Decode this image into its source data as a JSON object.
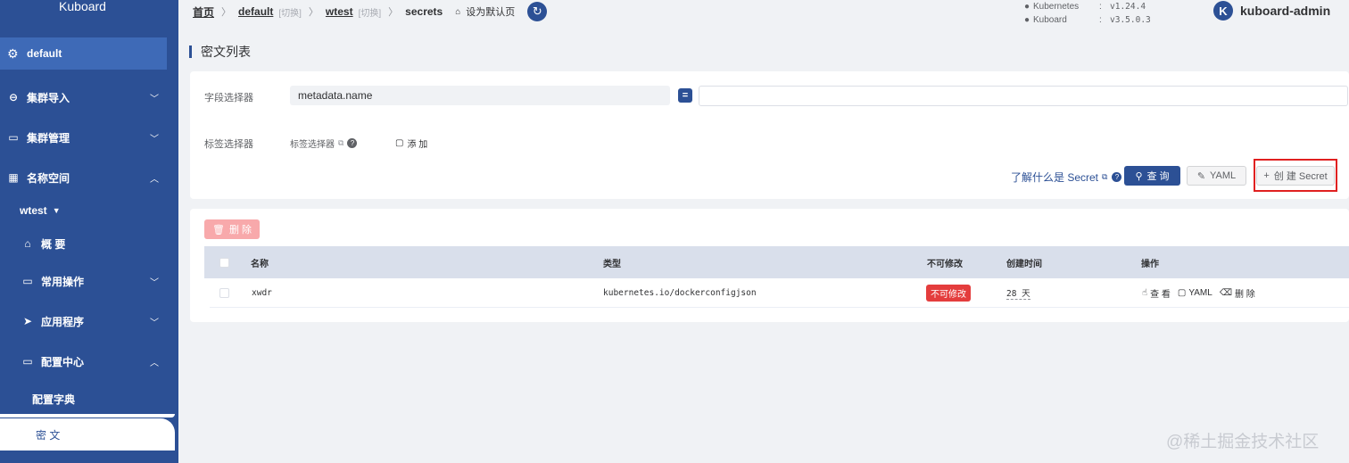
{
  "sidebar": {
    "brand": "Kuboard",
    "cluster": {
      "label": "default",
      "icon": "gear-icon"
    },
    "items": [
      {
        "label": "集群导入",
        "icon": "link-icon",
        "chevron": "﹀"
      },
      {
        "label": "集群管理",
        "icon": "folder-icon",
        "chevron": "﹀"
      },
      {
        "label": "名称空间",
        "icon": "grid-icon",
        "chevron": "︿"
      }
    ],
    "namespace": "wtest",
    "ns_items": [
      {
        "label": "概 要",
        "icon": "home-icon"
      },
      {
        "label": "常用操作",
        "icon": "folder-icon",
        "chevron": "﹀"
      },
      {
        "label": "应用程序",
        "icon": "send-icon",
        "chevron": "﹀"
      },
      {
        "label": "配置中心",
        "icon": "box-icon",
        "chevron": "︿"
      }
    ],
    "config_items": [
      {
        "label": "配置字典"
      },
      {
        "label": "密 文",
        "active": true
      }
    ]
  },
  "topbar": {
    "home": "首页",
    "cluster": "default",
    "cluster_switch": "[切换]",
    "namespace": "wtest",
    "namespace_switch": "[切换]",
    "resource": "secrets",
    "set_default": "设为默认页",
    "versions": [
      {
        "name": "Kubernetes",
        "value": "v1.24.4"
      },
      {
        "name": "Kuboard",
        "value": "v3.5.0.3"
      }
    ],
    "user_initial": "K",
    "user_name": "kuboard-admin"
  },
  "page": {
    "title": "密文列表"
  },
  "filter": {
    "field_selector_label": "字段选择器",
    "field_value": "metadata.name",
    "operator": "=",
    "label_selector_label": "标签选择器",
    "label_selector_link": "标签选择器",
    "add_label": "添 加",
    "learn_link": "了解什么是 Secret",
    "query_button": "查 询",
    "yaml_button": "YAML",
    "create_button": "创 建 Secret"
  },
  "table": {
    "delete_button": "删 除",
    "columns": [
      "名称",
      "类型",
      "不可修改",
      "创建时间",
      "操作"
    ],
    "rows": [
      {
        "name": "xwdr",
        "type": "kubernetes.io/dockerconfigjson",
        "immutable": "不可修改",
        "age": "28 天",
        "actions": [
          "查 看",
          "YAML",
          "删 除"
        ]
      }
    ]
  },
  "watermark": "@稀土掘金技术社区"
}
